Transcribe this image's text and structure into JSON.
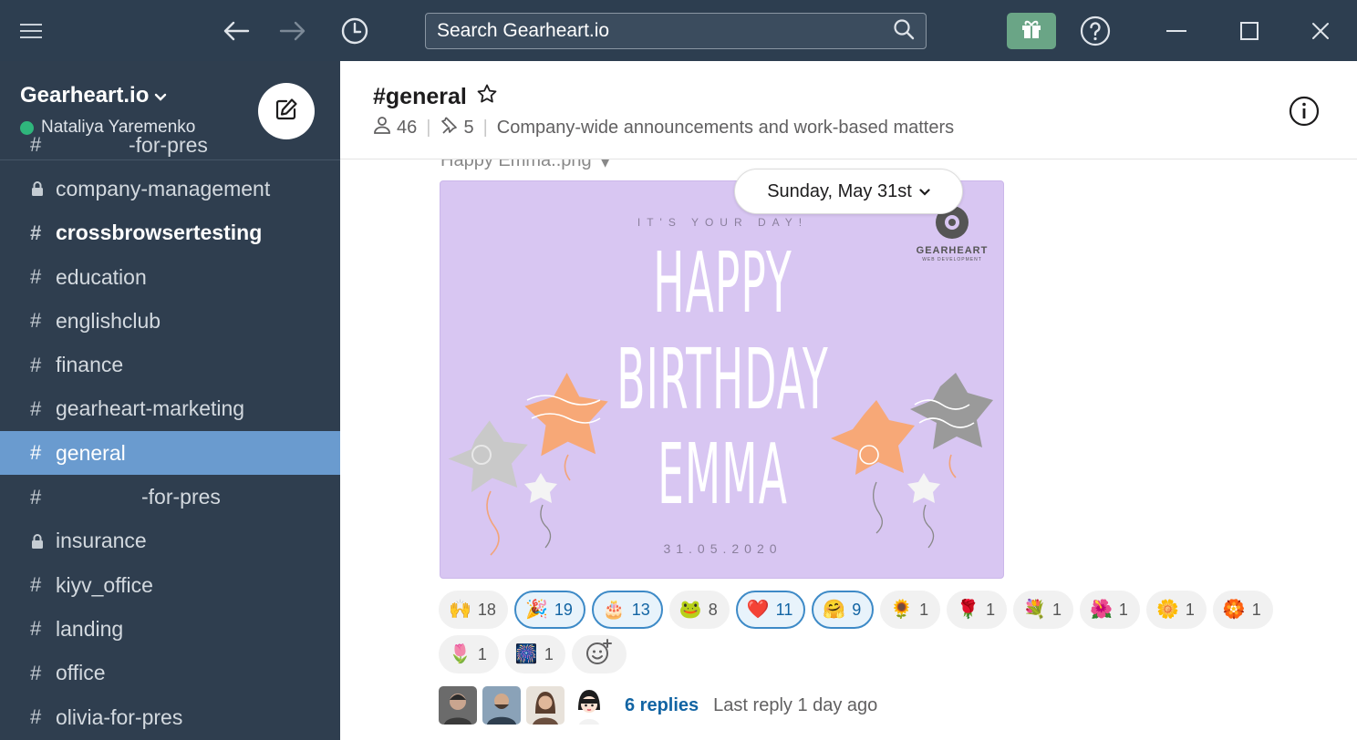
{
  "titlebar": {
    "search_placeholder": "Search Gearheart.io"
  },
  "workspace": {
    "name": "Gearheart.io",
    "user": "Nataliya Yaremenko"
  },
  "sidebar": {
    "channels": [
      {
        "symbol": "#",
        "prefix": "",
        "name": "-for-pres",
        "state": "normal"
      },
      {
        "symbol": "lock",
        "prefix": "",
        "name": "company-management",
        "state": "normal"
      },
      {
        "symbol": "#",
        "prefix": "",
        "name": "crossbrowsertesting",
        "state": "unread"
      },
      {
        "symbol": "#",
        "prefix": "",
        "name": "education",
        "state": "normal"
      },
      {
        "symbol": "#",
        "prefix": "",
        "name": "englishclub",
        "state": "normal"
      },
      {
        "symbol": "#",
        "prefix": "",
        "name": "finance",
        "state": "normal"
      },
      {
        "symbol": "#",
        "prefix": "",
        "name": "gearheart-marketing",
        "state": "normal"
      },
      {
        "symbol": "#",
        "prefix": "",
        "name": "general",
        "state": "active"
      },
      {
        "symbol": "#",
        "prefix": "",
        "name": "-for-pres",
        "state": "normal"
      },
      {
        "symbol": "lock",
        "prefix": "",
        "name": "insurance",
        "state": "normal"
      },
      {
        "symbol": "#",
        "prefix": "",
        "name": "kiyv_office",
        "state": "normal"
      },
      {
        "symbol": "#",
        "prefix": "",
        "name": "landing",
        "state": "normal"
      },
      {
        "symbol": "#",
        "prefix": "",
        "name": "office",
        "state": "normal"
      },
      {
        "symbol": "#",
        "prefix": "",
        "name": "olivia-for-pres",
        "state": "normal"
      }
    ]
  },
  "channel": {
    "title": "#general",
    "members": "46",
    "pins": "5",
    "topic": "Company-wide announcements and work-based matters"
  },
  "message": {
    "file_name": "Happy Emma..png",
    "date_divider": "Sunday, May 31st",
    "image": {
      "kicker": "IT'S YOUR DAY!",
      "line1": "HAPPY",
      "line2": "BIRTHDAY",
      "line3": "EMMA",
      "date": "31.05.2020",
      "logo": "GEARHEART",
      "logo_sub": "WEB DEVELOPMENT"
    },
    "reactions": [
      {
        "emoji": "🙌",
        "count": "18",
        "mine": false
      },
      {
        "emoji": "🎉",
        "count": "19",
        "mine": true
      },
      {
        "emoji": "🎂",
        "count": "13",
        "mine": true
      },
      {
        "emoji": "🐸",
        "count": "8",
        "mine": false
      },
      {
        "emoji": "❤️",
        "count": "11",
        "mine": true
      },
      {
        "emoji": "🤗",
        "count": "9",
        "mine": true
      },
      {
        "emoji": "🌻",
        "count": "1",
        "mine": false
      },
      {
        "emoji": "🌹",
        "count": "1",
        "mine": false
      },
      {
        "emoji": "💐",
        "count": "1",
        "mine": false
      },
      {
        "emoji": "🌺",
        "count": "1",
        "mine": false
      },
      {
        "emoji": "🌼",
        "count": "1",
        "mine": false
      },
      {
        "emoji": "🏵️",
        "count": "1",
        "mine": false
      },
      {
        "emoji": "🌷",
        "count": "1",
        "mine": false
      },
      {
        "emoji": "🎆",
        "count": "1",
        "mine": false
      }
    ],
    "replies": "6 replies",
    "last_reply": "Last reply 1 day ago"
  },
  "colors": {
    "sidebar_bg": "#2f3e4f",
    "titlebar_bg": "#2d3e50",
    "active_channel": "#6a9bcf",
    "link": "#1264a3",
    "presence": "#2fb67c"
  }
}
